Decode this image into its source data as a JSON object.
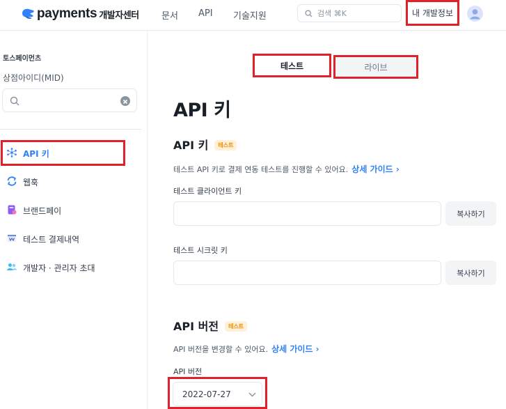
{
  "header": {
    "logo_word": "payments",
    "logo_sub": "개발자센터",
    "nav": [
      "문서",
      "API",
      "기술지원"
    ],
    "search_placeholder": "검색 ⌘K",
    "my_info": "내 개발정보"
  },
  "sidebar": {
    "shop_name": "토스페이먼츠",
    "mid_label": "상점아이디(MID)",
    "mid_value": "",
    "items": [
      {
        "label": "API 키",
        "icon": "key-spark-icon",
        "active": true
      },
      {
        "label": "웹훅",
        "icon": "refresh-arrows-icon"
      },
      {
        "label": "브랜드페이",
        "icon": "brandpay-icon"
      },
      {
        "label": "테스트 결제내역",
        "icon": "receipt-icon"
      },
      {
        "label": "개발자 · 관리자 초대",
        "icon": "people-icon"
      }
    ]
  },
  "main": {
    "segments": {
      "test": "테스트",
      "live": "라이브"
    },
    "title": "API 키",
    "api_key_section": {
      "title": "API 키",
      "badge": "테스트",
      "desc": "테스트 API 키로 결제 연동 테스트를 진행할 수 있어요.",
      "guide": "상세 가이드 ›",
      "client_key_label": "테스트 클라이언트 키",
      "client_key_value": "",
      "secret_key_label": "테스트 시크릿 키",
      "secret_key_value": "",
      "copy_label": "복사하기"
    },
    "version_section": {
      "title": "API 버전",
      "badge": "테스트",
      "desc": "API 버전을 변경할 수 있어요.",
      "guide": "상세 가이드 ›",
      "label": "API 버전",
      "value": "2022-07-27"
    }
  },
  "colors": {
    "accent": "#3182f6",
    "highlight": "#e0202a",
    "badge_bg": "#fff1d9",
    "badge_text": "#f08c00"
  }
}
